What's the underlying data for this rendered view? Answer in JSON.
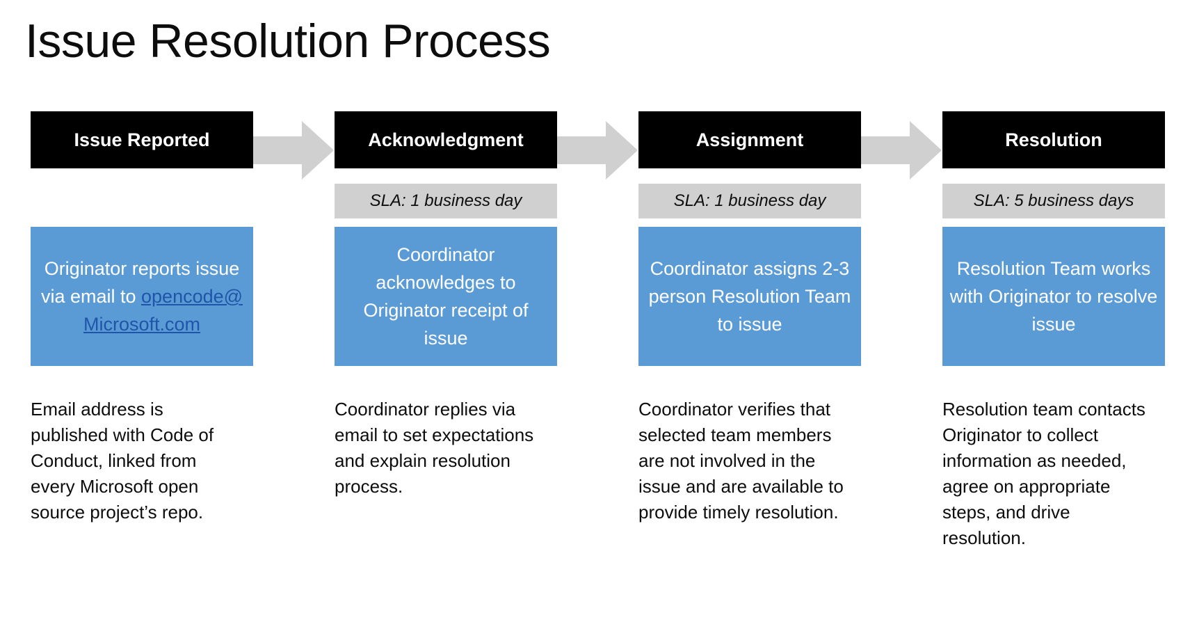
{
  "title": "Issue Resolution Process",
  "colors": {
    "stage_header_bg": "#000000",
    "stage_header_text": "#ffffff",
    "sla_bg": "#d0d0d0",
    "detail_bg": "#5b9bd5",
    "detail_text": "#ffffff",
    "link": "#1f55a8",
    "arrow": "#d0d0d0",
    "page_bg": "#ffffff",
    "body_text": "#0d0d0d"
  },
  "arrows": [
    {
      "name": "arrow-issue-to-acknowledgment"
    },
    {
      "name": "arrow-acknowledgment-to-assignment"
    },
    {
      "name": "arrow-assignment-to-resolution"
    }
  ],
  "stages": [
    {
      "id": "issue-reported",
      "header": "Issue Reported",
      "sla": "",
      "detail_prefix": "Originator reports issue via email to ",
      "detail_link": "opencode@Microsoft.com",
      "detail_suffix": "",
      "note": "Email address is published with Code of Conduct, linked from every Microsoft open source project’s repo."
    },
    {
      "id": "acknowledgment",
      "header": "Acknowledgment",
      "sla": "SLA: 1 business day",
      "detail_prefix": "Coordinator acknowledges to Originator receipt of issue",
      "detail_link": "",
      "detail_suffix": "",
      "note": "Coordinator replies via email to set expectations and explain resolution process."
    },
    {
      "id": "assignment",
      "header": "Assignment",
      "sla": "SLA: 1 business day",
      "detail_prefix": "Coordinator assigns 2-3 person Resolution Team to issue",
      "detail_link": "",
      "detail_suffix": "",
      "note": "Coordinator verifies that selected team members are not involved in the issue and are available to provide timely resolution."
    },
    {
      "id": "resolution",
      "header": "Resolution",
      "sla": "SLA: 5 business days",
      "detail_prefix": "Resolution Team works with Originator to resolve issue",
      "detail_link": "",
      "detail_suffix": "",
      "note": "Resolution team contacts Originator to collect information as needed, agree on appropriate steps, and drive resolution."
    }
  ]
}
